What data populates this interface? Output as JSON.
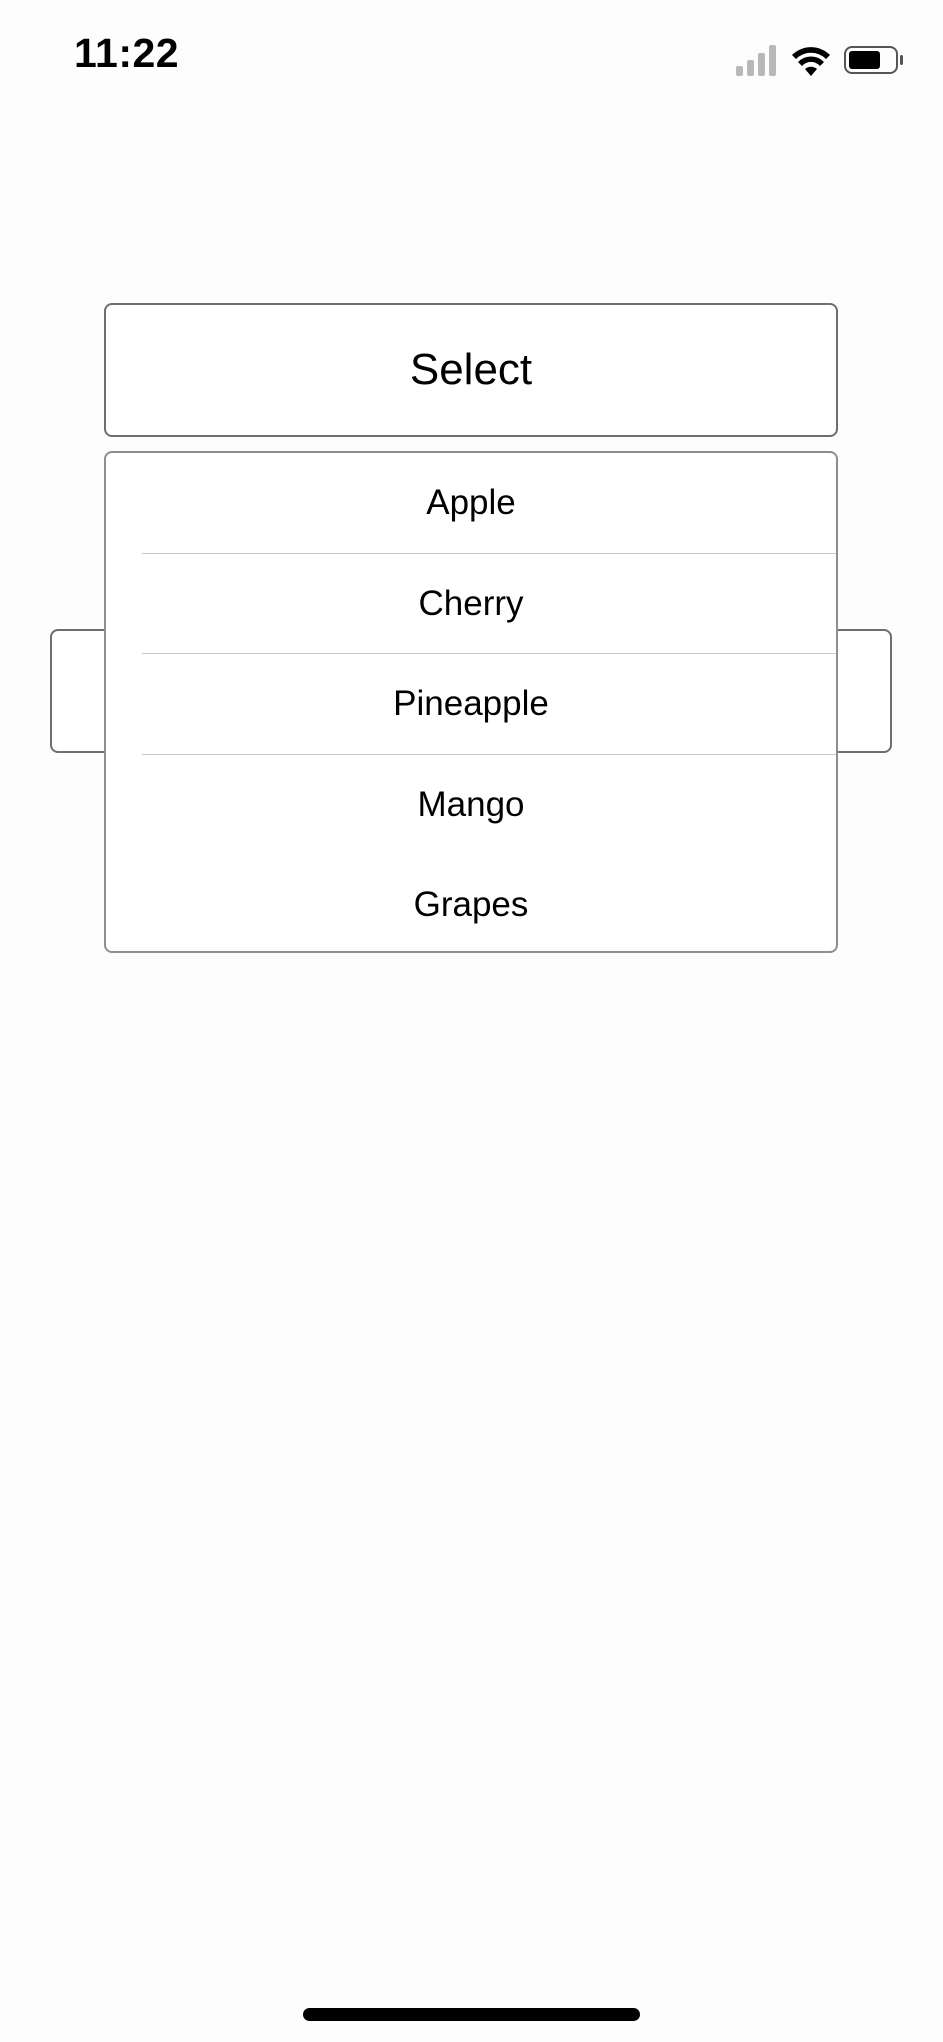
{
  "status_bar": {
    "time": "11:22",
    "icons": [
      "cellular-signal-icon",
      "wifi-icon",
      "battery-icon"
    ],
    "battery_level": 0.7
  },
  "select_button": {
    "label": "Select"
  },
  "dropdown": {
    "items": [
      {
        "label": "Apple"
      },
      {
        "label": "Cherry"
      },
      {
        "label": "Pineapple"
      },
      {
        "label": "Mango"
      },
      {
        "label": "Grapes"
      }
    ]
  },
  "colors": {
    "border": "#6e6e6e",
    "separator": "#c8c8c8",
    "background": "#fdfdfd"
  }
}
